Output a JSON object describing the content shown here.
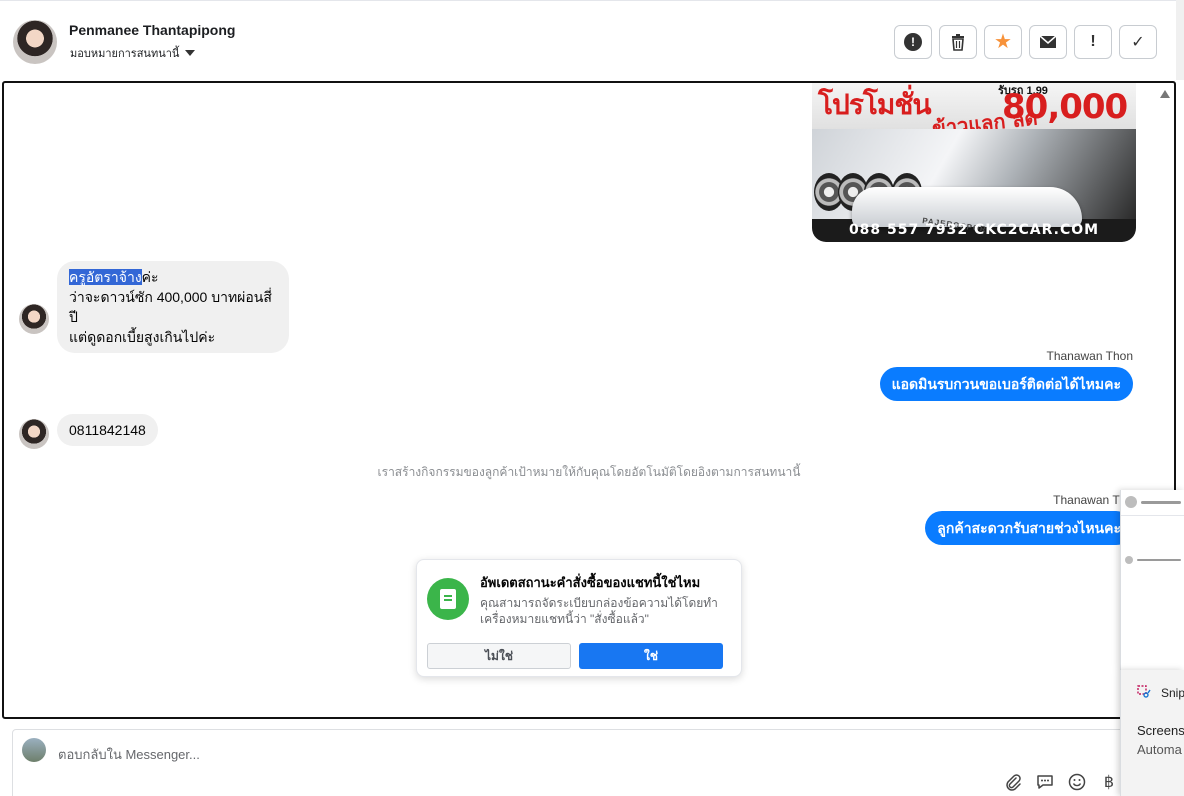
{
  "header": {
    "contact_name": "Penmanee Thantapipong",
    "assign_label": "มอบหมายการสนทนานี้",
    "actions": [
      {
        "name": "report-spam",
        "symbol": "!",
        "style": "circle"
      },
      {
        "name": "delete",
        "symbol": "🗑"
      },
      {
        "name": "star",
        "symbol": "★"
      },
      {
        "name": "mark-unread",
        "symbol": "✉"
      },
      {
        "name": "flag",
        "symbol": "!"
      },
      {
        "name": "done",
        "symbol": "✓"
      }
    ]
  },
  "promo": {
    "title": "โปรโมชั่น",
    "sub": "ข้าวแลก ลด",
    "amount": "80,000",
    "rub": "รับรถ 1.99",
    "badge": "PAJEROSPORT",
    "phone": "088 557 7932 CKC2CAR.COM"
  },
  "messages": {
    "incoming_1": {
      "highlight": "ครูอัตราจ้าง",
      "rest": "ค่ะ",
      "line2": "ว่าจะดาวน์ซัก 400,000 บาทผ่อนสี่ปี",
      "line3": "แต่ดูดอกเบี้ยสูงเกินไปค่ะ"
    },
    "outgoing_1": {
      "sender": "Thanawan Thon",
      "text": "แอดมินรบกวนขอเบอร์ติดต่อได้ไหมคะ"
    },
    "incoming_2": {
      "text": "0811842148"
    },
    "system_note": "เราสร้างกิจกรรมของลูกค้าเป้าหมายให้กับคุณโดยอัตโนมัติโดยอิงตามการสนทนานี้",
    "outgoing_2": {
      "sender": "Thanawan Tho",
      "text": "ลูกค้าสะดวกรับสายช่วงไหนคะ"
    }
  },
  "order_card": {
    "title": "อัพเดตสถานะคำสั่งซื้อของแชทนี้ใช่ไหม",
    "body": "คุณสามารถจัดระเบียบกล่องข้อความได้โดยทำเครื่องหมายแชทนี้ว่า \"สั่งซื้อแล้ว\"",
    "no_label": "ไม่ใช่",
    "yes_label": "ใช่"
  },
  "composer": {
    "placeholder": "ตอบกลับใน Messenger...",
    "tools": [
      {
        "name": "attach",
        "symbol": "📎"
      },
      {
        "name": "saved-replies",
        "symbol": "💬"
      },
      {
        "name": "emoji",
        "symbol": "☺"
      },
      {
        "name": "payment",
        "symbol": "฿"
      }
    ]
  },
  "snip": {
    "name": "Snip",
    "line1": "Screens",
    "line2": "Automa"
  },
  "colors": {
    "accent": "#0a7cff",
    "button_blue": "#1877f2",
    "success": "#3bb54a",
    "star": "#f7923a"
  }
}
